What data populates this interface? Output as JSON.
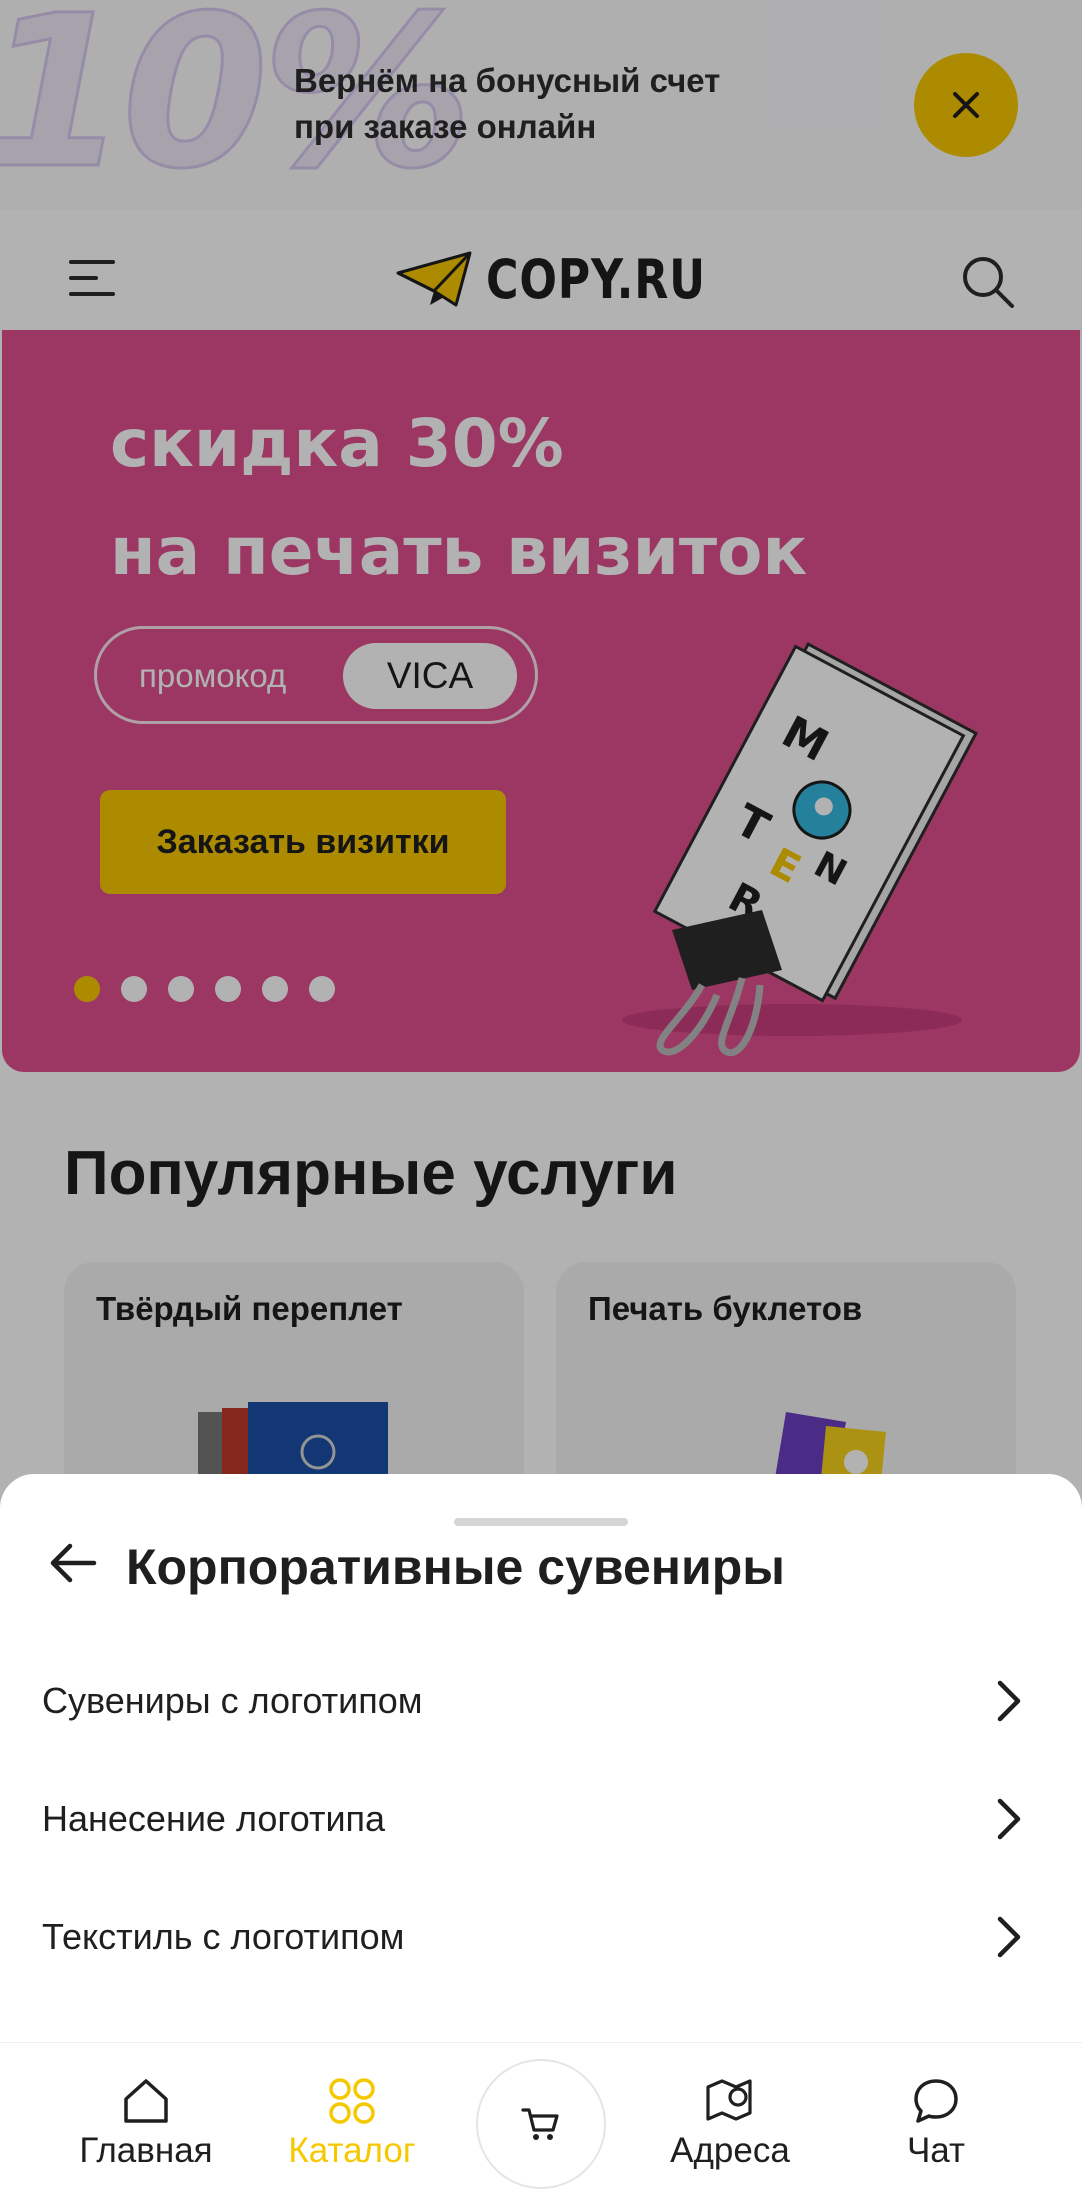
{
  "promo_strip": {
    "big_text": "10%",
    "line1": "Вернём на бонусный счет",
    "line2": "при заказе онлайн"
  },
  "header": {
    "logo_text": "COPY.RU"
  },
  "banner": {
    "title_line1": "скидка 30%",
    "title_line2": "на печать визиток",
    "promo_label": "промокод",
    "promo_code": "VICA",
    "cta_label": "Заказать визитки",
    "slide_count": 6,
    "active_slide": 1
  },
  "popular": {
    "title": "Популярные услуги",
    "cards": [
      {
        "label": "Твёрдый переплет"
      },
      {
        "label": "Печать буклетов"
      }
    ]
  },
  "sheet": {
    "title": "Корпоративные сувениры",
    "items": [
      {
        "label": "Сувениры с логотипом"
      },
      {
        "label": "Нанесение логотипа"
      },
      {
        "label": "Текстиль с логотипом"
      }
    ]
  },
  "tabbar": {
    "tabs": [
      {
        "label": "Главная",
        "icon": "home-icon"
      },
      {
        "label": "Каталог",
        "icon": "catalog-icon",
        "active": true
      },
      {
        "label": "Адреса",
        "icon": "map-pin-icon"
      },
      {
        "label": "Чат",
        "icon": "chat-icon"
      }
    ],
    "cart_icon": "cart-icon"
  },
  "colors": {
    "accent": "#f6c800",
    "banner_bg": "#e0508f",
    "overlay": "rgba(0,0,0,0.30)"
  }
}
